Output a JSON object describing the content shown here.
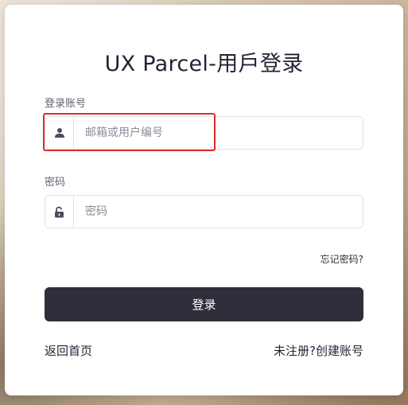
{
  "login": {
    "title": "UX Parcel-用戶登录",
    "account_label": "登录账号",
    "account_placeholder": "邮箱或用户编号",
    "password_label": "密码",
    "password_placeholder": "密码",
    "forgot_link": "忘记密码?",
    "submit_label": "登录",
    "home_link": "返回首页",
    "register_link": "未注册?创建账号"
  },
  "icons": {
    "account": "user-icon",
    "password": "unlock-icon"
  },
  "colors": {
    "button_bg": "#2e2f3a",
    "highlight_border": "#e02b2b",
    "icon": "#4a4e5a"
  }
}
